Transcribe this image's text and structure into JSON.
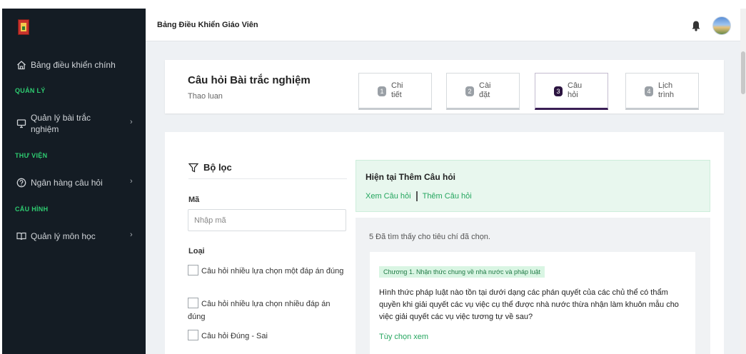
{
  "app": {
    "title": "Bảng Điều Khiển Giáo Viên"
  },
  "sidebar": {
    "dashboard_label": "Bảng điều khiển chính",
    "sections": {
      "management": "QUẢN LÝ",
      "library": "THƯ VIỆN",
      "config": "CẤU HÌNH"
    },
    "quiz_mgmt_label_line1": "Quản lý bài trắc",
    "quiz_mgmt_label_line2": "nghiệm",
    "question_bank_label": "Ngân hàng câu hỏi",
    "subject_mgmt_label": "Quản lý môn học",
    "chevron": "›"
  },
  "header": {
    "title": "Câu hỏi Bài trắc nghiệm",
    "subtitle": "Thao luan",
    "steps": [
      {
        "num": "1",
        "line1": "Chi",
        "line2": "tiết",
        "active": false
      },
      {
        "num": "2",
        "line1": "Cài",
        "line2": "đặt",
        "active": false
      },
      {
        "num": "3",
        "line1": "Câu",
        "line2": "hỏi",
        "active": true
      },
      {
        "num": "4",
        "line1": "Lịch",
        "line2": "trình",
        "active": false
      }
    ]
  },
  "filter": {
    "title": "Bộ lọc",
    "code_label": "Mã",
    "code_placeholder": "Nhập mã",
    "type_label": "Loại",
    "types": [
      "Câu hỏi nhiều lựa chọn một đáp án đúng",
      "Câu hỏi nhiều lựa chọn nhiều đáp án đúng",
      "Câu hỏi Đúng - Sai"
    ]
  },
  "current": {
    "title": "Hiện tại Thêm Câu hỏi",
    "view_link": "Xem Câu hỏi",
    "add_link": "Thêm Câu hỏi"
  },
  "results": {
    "count_text": "5 Đã tìm thấy cho tiêu chí đã chọn.",
    "question": {
      "chapter": "Chương 1. Nhận thức chung về nhà nước và pháp luật",
      "text": "Hình thức pháp luật nào tồn tại dưới dạng các phán quyết của các chủ thể có thẩm quyền khi giải quyết các vụ việc cụ thể được nhà nước thừa nhận làm khuôn mẫu cho việc giải quyết các vụ việc tương tự về sau?",
      "option_link": "Tùy chọn xem"
    }
  },
  "colors": {
    "sidebar_bg": "#141c24",
    "accent_green": "#2ecc71",
    "link_green": "#25a65f",
    "active_step": "#3a1f55"
  }
}
